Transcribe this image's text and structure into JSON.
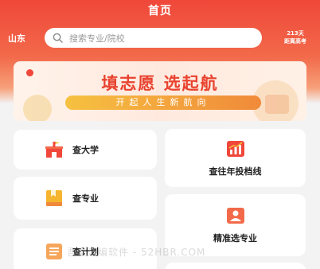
{
  "header": {
    "title": "首页",
    "region": "山东",
    "search_placeholder": "搜索专业/院校",
    "countdown_days": "213天",
    "countdown_label": "距离高考"
  },
  "banner": {
    "main_text": "填志愿 选起航",
    "sub_text": "开起人生新航向"
  },
  "menu": {
    "left": [
      {
        "label": "查大学",
        "icon": "university-icon"
      },
      {
        "label": "查专业",
        "icon": "major-book-icon"
      },
      {
        "label": "查计划",
        "icon": "plan-list-icon"
      }
    ],
    "right": [
      {
        "label": "查往年投档线",
        "icon": "score-line-chart-icon"
      },
      {
        "label": "精准选专业",
        "icon": "person-select-icon"
      }
    ]
  },
  "watermark": "吾爱汇编软件 - 52HBR.COM",
  "colors": {
    "brand": "#f0473a",
    "accent_orange": "#f08a3a",
    "background": "#f3f3f3"
  }
}
